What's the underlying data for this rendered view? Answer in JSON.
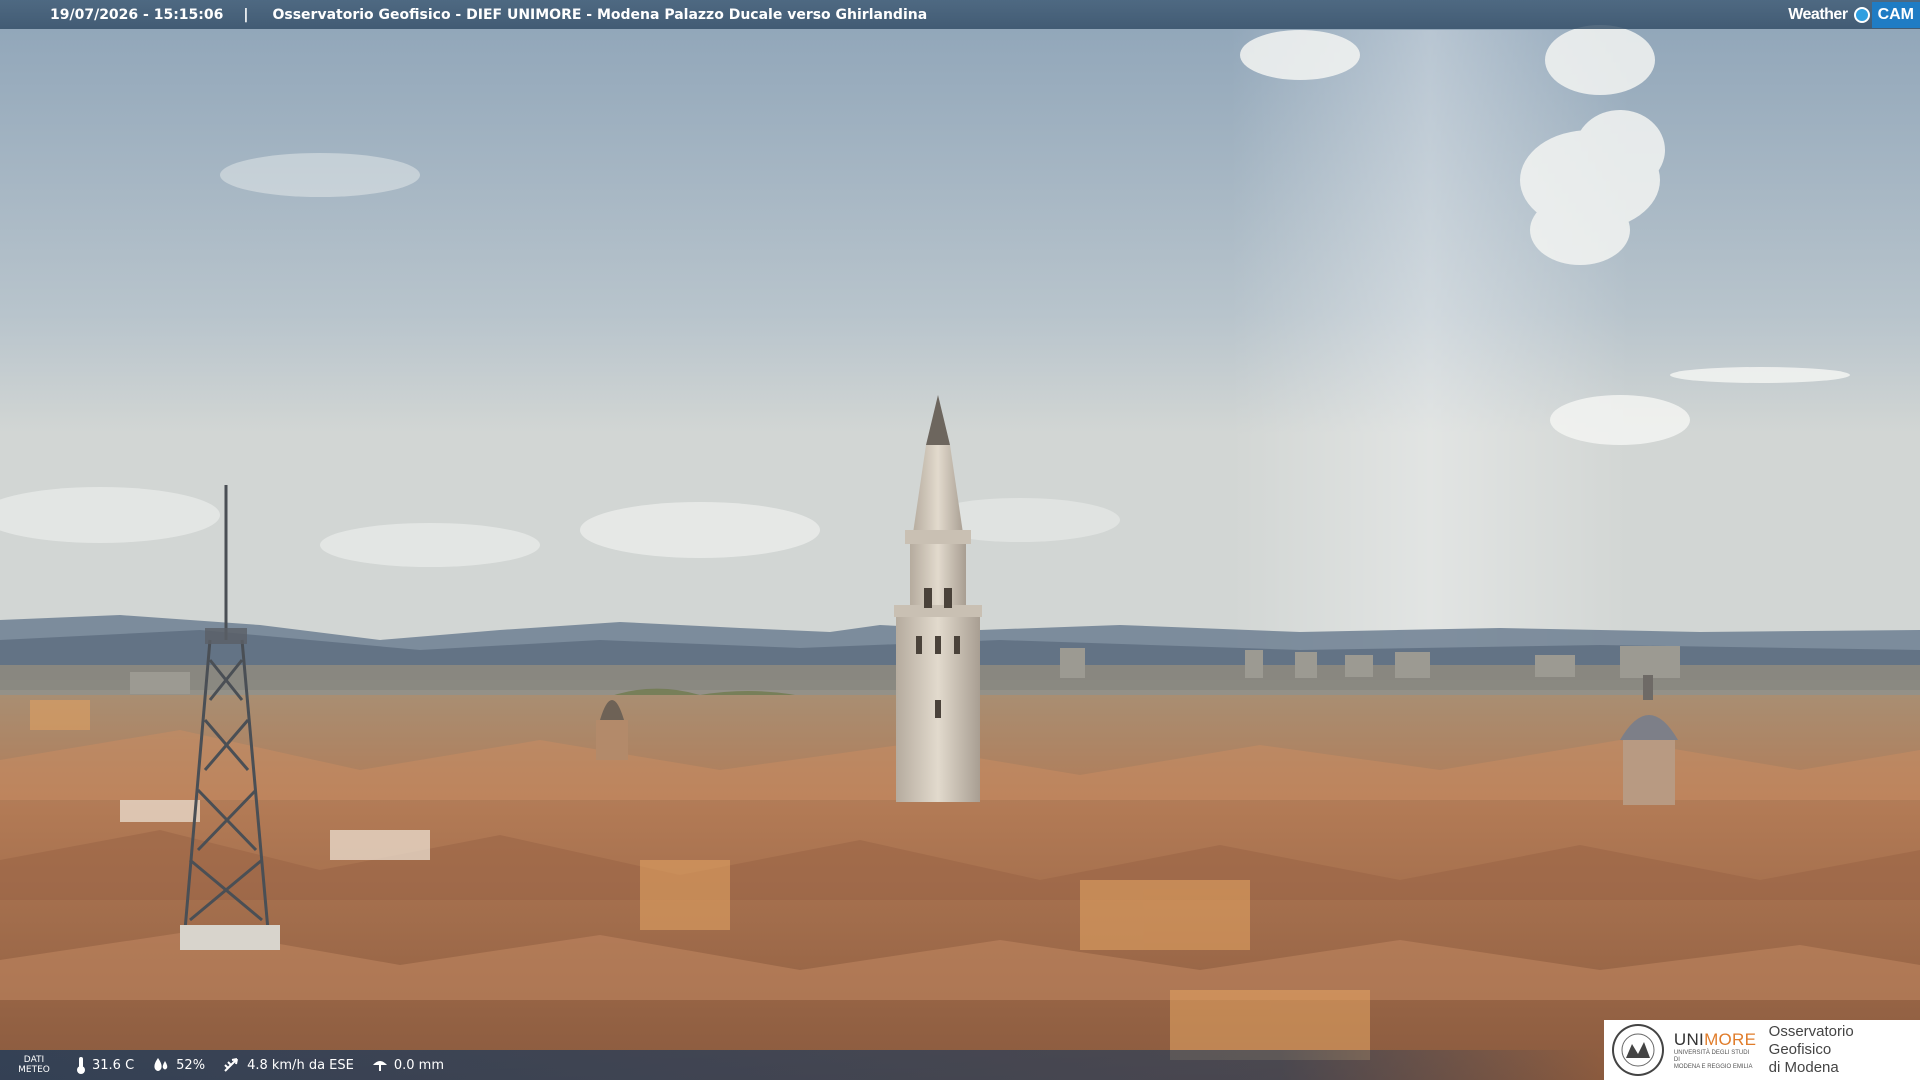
{
  "header": {
    "timestamp": "19/07/2026 - 15:15:06",
    "separator": "|",
    "camera_title": "Osservatorio Geofisico - DIEF UNIMORE - Modena Palazzo Ducale verso Ghirlandina"
  },
  "branding": {
    "weathercam_word": "Weather",
    "weathercam_cam": "CAM"
  },
  "meteo": {
    "label_line1": "DATI",
    "label_line2": "METEO",
    "temperature": "31.6 C",
    "humidity": "52%",
    "wind": "4.8 km/h da ESE",
    "rain": "0.0 mm",
    "icons": [
      "thermometer-icon",
      "humidity-icon",
      "wind-icon",
      "rain-icon"
    ]
  },
  "logo": {
    "uni_part1": "UNI",
    "uni_part2": "MORE",
    "uni_sub1": "UNIVERSITÀ DEGLI STUDI DI",
    "uni_sub2": "MODENA E REGGIO EMILIA",
    "obs_line1": "Osservatorio Geofisico",
    "obs_line2": "di Modena"
  },
  "colors": {
    "sky_top": "#9aaebf",
    "sky_mid": "#c7d0d6",
    "roofs": "#b87a52",
    "tower": "#d8d0c4",
    "accent_orange": "#e07c2a"
  }
}
